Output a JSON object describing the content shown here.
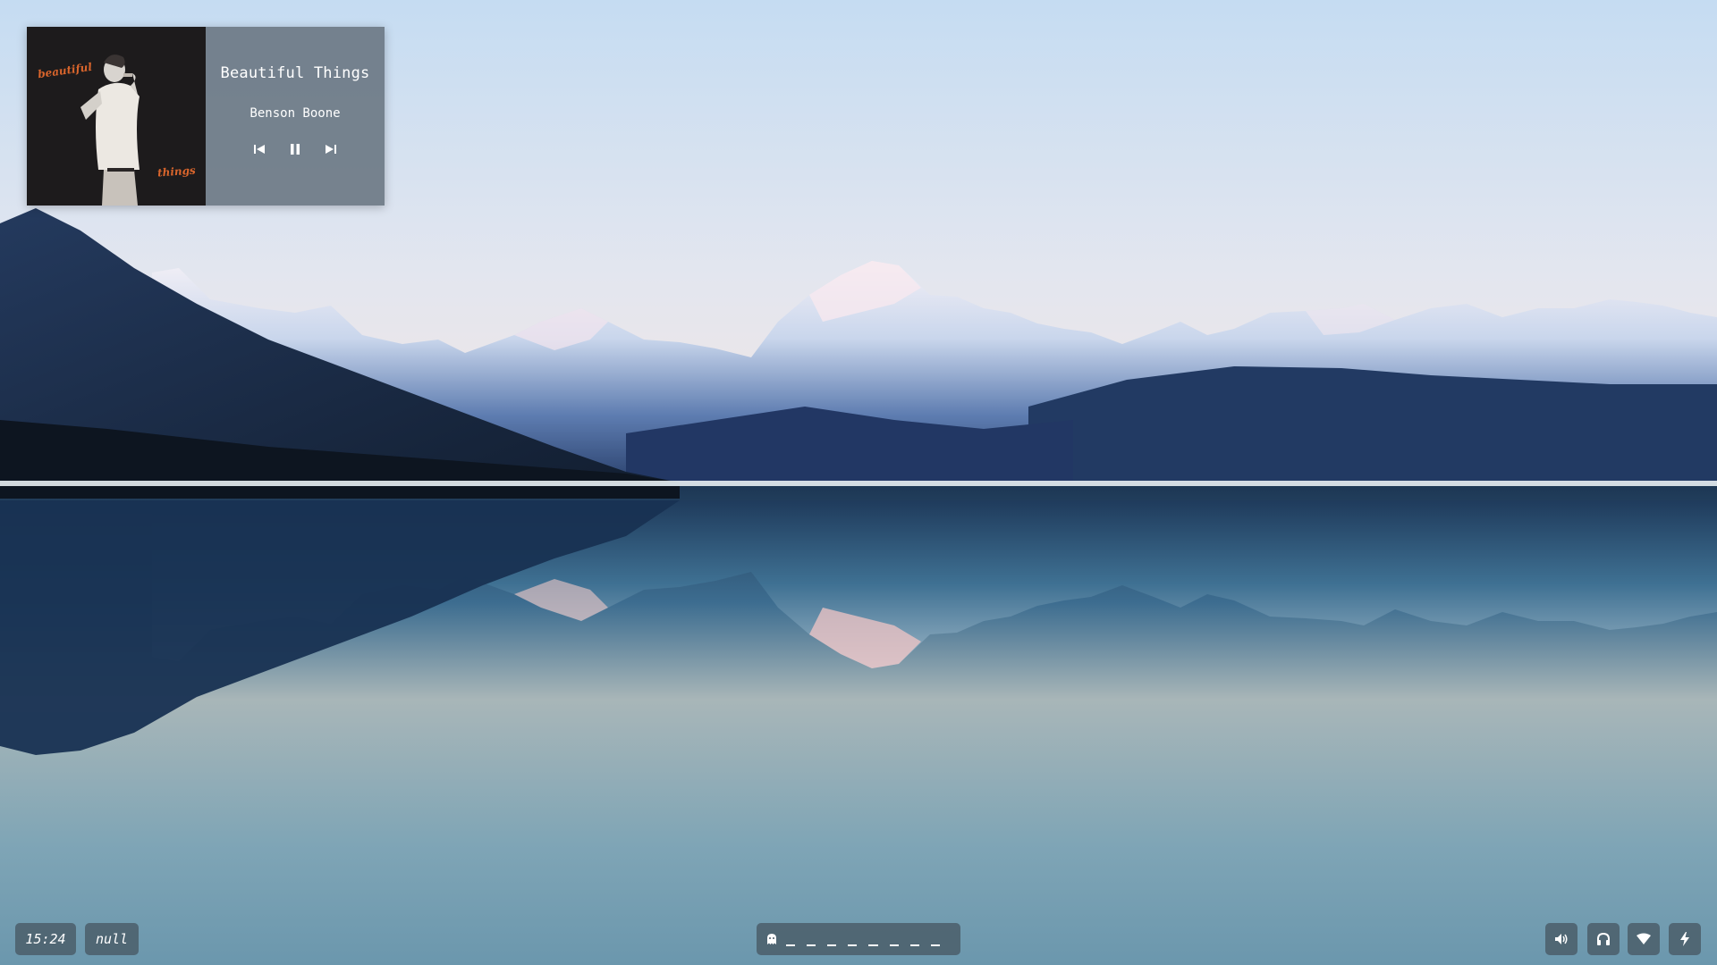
{
  "media_player": {
    "title": "Beautiful Things",
    "artist": "Benson Boone",
    "cover_text": [
      "beautiful",
      "things"
    ],
    "controls": {
      "previous_icon": "skip-previous-icon",
      "pause_icon": "pause-icon",
      "next_icon": "skip-next-icon"
    }
  },
  "bar": {
    "clock": "15:24",
    "window_title": "null",
    "workspaces": {
      "icon": "ghost-icon",
      "count": 8
    },
    "tray": [
      {
        "name": "volume",
        "icon": "volume-icon"
      },
      {
        "name": "headphones",
        "icon": "headphones-icon"
      },
      {
        "name": "wifi",
        "icon": "wifi-icon"
      },
      {
        "name": "power",
        "icon": "lightning-bolt-icon"
      }
    ]
  },
  "colors": {
    "bar_pill": "#485864",
    "player_panel": "#687480",
    "cover_accent": "#d9652c"
  }
}
